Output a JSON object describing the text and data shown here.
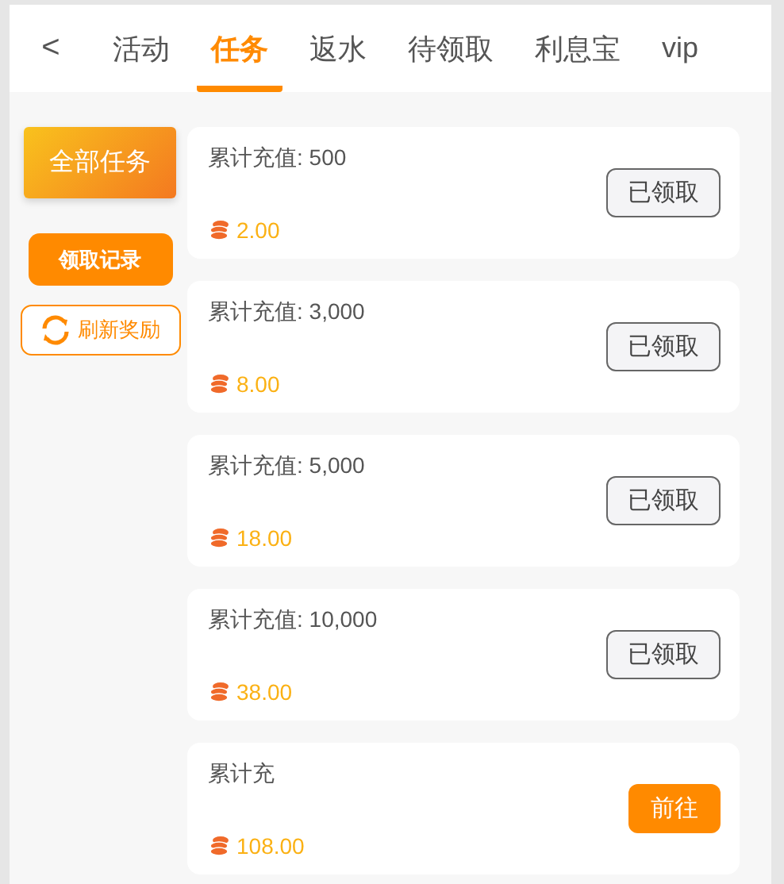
{
  "back_button": {
    "label": "<"
  },
  "tabs": [
    {
      "label": "活动",
      "selected": false
    },
    {
      "label": "任务",
      "selected": true
    },
    {
      "label": "返水",
      "selected": false
    },
    {
      "label": "待领取",
      "selected": false
    },
    {
      "label": "利息宝",
      "selected": false
    },
    {
      "label": "vip",
      "selected": false
    }
  ],
  "sidebar": {
    "category": {
      "label": "全部任务",
      "selected": true
    },
    "history_button": "领取记录",
    "refresh_button": "刷新奖励"
  },
  "tasks": [
    {
      "title": "累计充值: 500",
      "reward": "2.00",
      "action": "已领取",
      "kind": "claimed"
    },
    {
      "title": "累计充值: 3,000",
      "reward": "8.00",
      "action": "已领取",
      "kind": "claimed"
    },
    {
      "title": "累计充值: 5,000",
      "reward": "18.00",
      "action": "已领取",
      "kind": "claimed"
    },
    {
      "title": "累计充值: 10,000",
      "reward": "38.00",
      "action": "已领取",
      "kind": "claimed"
    },
    {
      "title": "累计充",
      "reward": "108.00",
      "action": "前往",
      "kind": "go"
    }
  ]
}
